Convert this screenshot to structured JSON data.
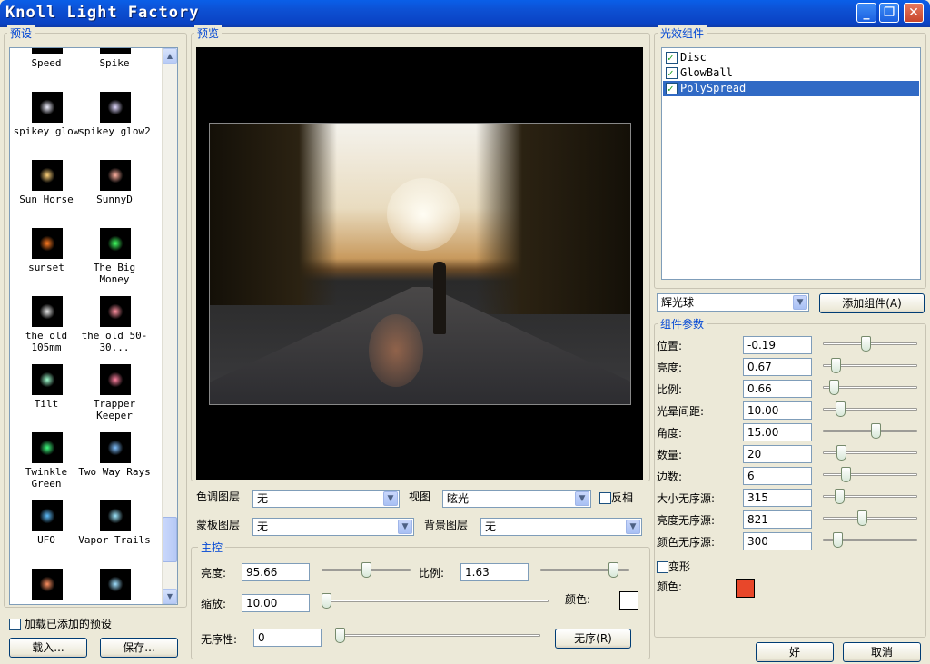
{
  "window": {
    "title": "Knoll Light Factory",
    "minimize_label": "_",
    "restore_label": "❐",
    "close_label": "✕"
  },
  "presets": {
    "group_label": "预设",
    "items": [
      [
        "Speed",
        "Spike"
      ],
      [
        "spikey glow",
        "spikey glow2"
      ],
      [
        "Sun Horse",
        "SunnyD"
      ],
      [
        "sunset",
        "The Big Money"
      ],
      [
        "the old 105mm",
        "the old 50-30..."
      ],
      [
        "Tilt",
        "Trapper Keeper"
      ],
      [
        "Twinkle Green",
        "Two Way Rays"
      ],
      [
        "UFO",
        "Vapor Trails"
      ]
    ],
    "load_added_label": "加载已添加的预设",
    "load_button": "载入...",
    "save_button": "保存..."
  },
  "preview": {
    "group_label": "预览"
  },
  "controls": {
    "tone_layer_label": "色调图层",
    "tone_layer_value": "无",
    "view_label": "视图",
    "view_value": "眩光",
    "invert_label": "反相",
    "mask_layer_label": "蒙板图层",
    "mask_layer_value": "无",
    "bg_layer_label": "背景图层",
    "bg_layer_value": "无"
  },
  "master": {
    "group_label": "主控",
    "brightness_label": "亮度:",
    "brightness_value": "95.66",
    "brightness_level": 0.5,
    "scale_label": "比例:",
    "scale_value": "1.63",
    "scale_level": 0.86,
    "zoom_label": "缩放:",
    "zoom_value": "10.00",
    "zoom_level": 0.0,
    "color_label": "颜色:",
    "color": "#ffffff",
    "random_label": "无序性:",
    "random_value": "0",
    "random_level": 0.0,
    "random_button": "无序(R)"
  },
  "components": {
    "group_label": "光效组件",
    "items": [
      {
        "name": "Disc",
        "checked": true
      },
      {
        "name": "GlowBall",
        "checked": true
      },
      {
        "name": "PolySpread",
        "checked": true,
        "selected": true
      }
    ],
    "type_value": "辉光球",
    "add_button": "添加组件(A)"
  },
  "params": {
    "group_label": "组件参数",
    "rows": [
      {
        "label": "位置:",
        "value": "-0.19",
        "level": 0.45
      },
      {
        "label": "亮度:",
        "value": "0.67",
        "level": 0.1
      },
      {
        "label": "比例:",
        "value": "0.66",
        "level": 0.08
      },
      {
        "label": "光晕间距:",
        "value": "10.00",
        "level": 0.15
      },
      {
        "label": "角度:",
        "value": "15.00",
        "level": 0.57
      },
      {
        "label": "数量:",
        "value": "20",
        "level": 0.16
      },
      {
        "label": "边数:",
        "value": "6",
        "level": 0.22
      },
      {
        "label": "大小无序源:",
        "value": "315",
        "level": 0.14
      },
      {
        "label": "亮度无序源:",
        "value": "821",
        "level": 0.41
      },
      {
        "label": "颜色无序源:",
        "value": "300",
        "level": 0.12
      }
    ],
    "deform_label": "变形",
    "color_label": "颜色:",
    "color": "#e8472a"
  },
  "footer": {
    "ok_button": "好",
    "cancel_button": "取消"
  },
  "colors": {
    "accent": "#0046d5",
    "selection": "#316ac5"
  }
}
